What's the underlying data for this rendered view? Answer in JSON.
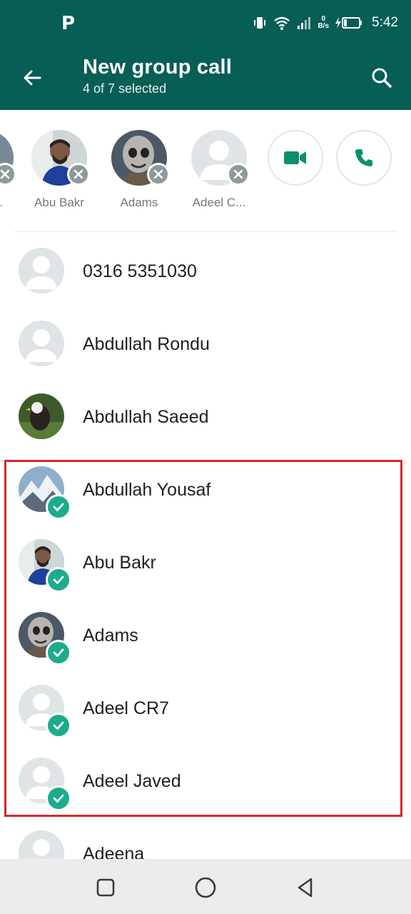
{
  "status_bar": {
    "notification_icon": "P",
    "time": "5:42",
    "net_speed_value": "0",
    "net_speed_unit": "B/s",
    "icons": [
      "vibrate-icon",
      "wifi-icon",
      "signal-icon",
      "battery-charging-icon"
    ]
  },
  "app_bar": {
    "title": "New group call",
    "subtitle": "4 of 7 selected"
  },
  "selected": [
    {
      "label": "Abu Bakr",
      "avatar": "photo-man"
    },
    {
      "label": "Adams",
      "avatar": "photo-robot"
    },
    {
      "label": "Adeel C...",
      "avatar": "default"
    }
  ],
  "selected_partial_label": "...",
  "actions": {
    "video_call": "video-call-icon",
    "voice_call": "voice-call-icon"
  },
  "contacts": [
    {
      "name": "0316 5351030",
      "avatar": "default",
      "selected": false
    },
    {
      "name": "Abdullah Rondu",
      "avatar": "default",
      "selected": false
    },
    {
      "name": "Abdullah Saeed",
      "avatar": "photo-eagle",
      "selected": false
    },
    {
      "name": "Abdullah Yousaf",
      "avatar": "photo-mountain",
      "selected": true
    },
    {
      "name": "Abu Bakr",
      "avatar": "photo-man",
      "selected": true
    },
    {
      "name": "Adams",
      "avatar": "photo-robot",
      "selected": true
    },
    {
      "name": "Adeel CR7",
      "avatar": "default",
      "selected": true
    },
    {
      "name": "Adeel Javed",
      "avatar": "default",
      "selected": true
    },
    {
      "name": "Adeena",
      "avatar": "default",
      "selected": false
    }
  ],
  "colors": {
    "header": "#075e54",
    "accent": "#1dab8e",
    "highlight": "#d7262e"
  }
}
